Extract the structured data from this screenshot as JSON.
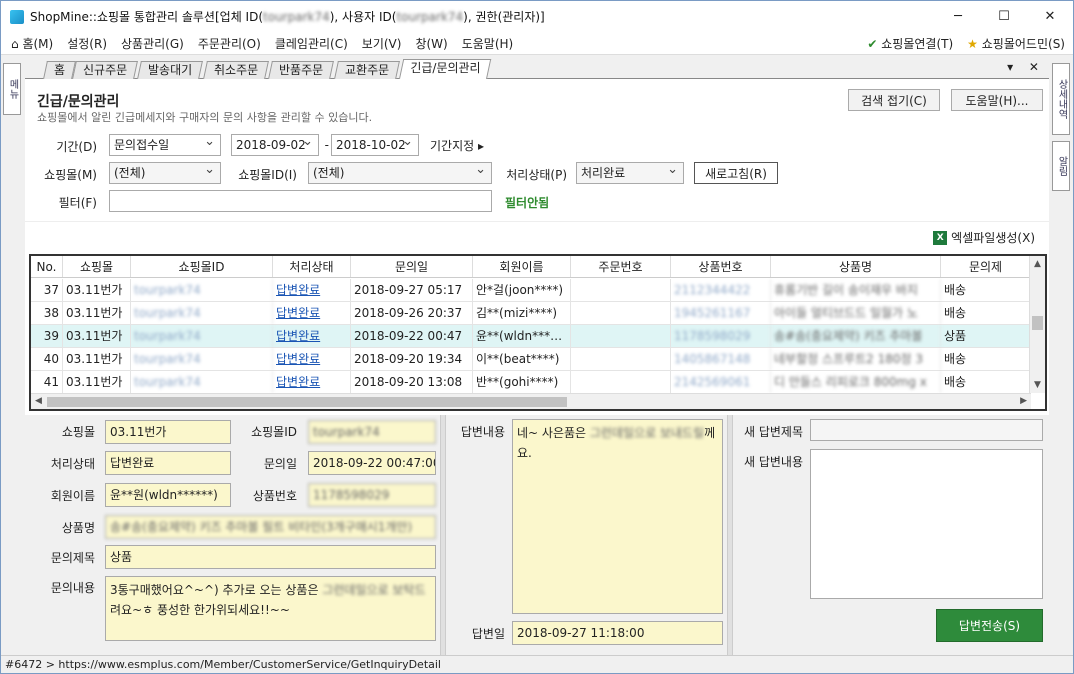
{
  "titlebar": {
    "title": "ShopMine::쇼핑몰 통합관리 솔루션[업체 ID(",
    "title_blur1": "tourpark74",
    "title_mid": "), 사용자 ID(",
    "title_blur2": "tourpark74",
    "title_end": "), 권한(관리자)]",
    "min": "─",
    "max": "☐",
    "close": "✕"
  },
  "menu": {
    "home": "홈(M)",
    "settings": "설정(R)",
    "product": "상품관리(G)",
    "order": "주문관리(O)",
    "claim": "클레임관리(C)",
    "view": "보기(V)",
    "window": "창(W)",
    "help": "도움말(H)",
    "mall_connect": "쇼핑몰연결(T)",
    "mall_admin": "쇼핑몰어드민(S)"
  },
  "side": {
    "menu": "메뉴",
    "detail": "상세내역",
    "alarm": "알림"
  },
  "tabs": [
    "홈",
    "신규주문",
    "발송대기",
    "취소주문",
    "반품주문",
    "교환주문",
    "긴급/문의관리"
  ],
  "tabctl": "▾ ✕",
  "panel": {
    "title": "긴급/문의관리",
    "subtitle": "쇼핑몰에서 알린 긴급메세지와 구매자의 문의 사항을 관리할 수 있습니다.",
    "collapse_btn": "검색 접기(C)",
    "help_btn": "도움말(H)...",
    "period_label": "기간(D)",
    "period_type": "문의접수일",
    "date_from": "2018-09-02",
    "date_sep": "-",
    "date_to": "2018-10-02",
    "period_set": "기간지정 ▸",
    "mall_label": "쇼핑몰(M)",
    "mall_value": "(전체)",
    "mallid_label": "쇼핑몰ID(I)",
    "mallid_value": "(전체)",
    "state_label": "처리상태(P)",
    "state_value": "처리완료",
    "refresh_btn": "새로고침(R)",
    "filter_label": "필터(F)",
    "filter_value": "",
    "filter_status": "필터안됨",
    "excel": "엑셀파일생성(X)"
  },
  "table": {
    "headers": [
      "No.",
      "쇼핑몰",
      "쇼핑몰ID",
      "처리상태",
      "문의일",
      "회원이름",
      "주문번호",
      "상품번호",
      "상품명",
      "문의제"
    ],
    "rows": [
      {
        "no": "37",
        "mall": "03.11번가",
        "mallid": "tourpark74",
        "state": "답변완료",
        "date": "2018-09-27 05:17",
        "member": "안*걸(joon****)",
        "order": "",
        "product_no": "2112344422",
        "product_name": "휴롬기반 길이 송이재우 바지",
        "type": "배송"
      },
      {
        "no": "38",
        "mall": "03.11번가",
        "mallid": "tourpark74",
        "state": "답변완료",
        "date": "2018-09-26 20:37",
        "member": "김**(mizi****)",
        "order": "",
        "product_no": "1945261167",
        "product_name": "아이들 얼티브드드 일월가 노",
        "type": "배송"
      },
      {
        "no": "39",
        "mall": "03.11번가",
        "mallid": "tourpark74",
        "state": "답변완료",
        "date": "2018-09-22 00:47",
        "member": "윤**(wldn***…",
        "order": "",
        "product_no": "1178598029",
        "product_name": "송#송(충요제약) 키즈 추마볼",
        "type": "상품"
      },
      {
        "no": "40",
        "mall": "03.11번가",
        "mallid": "tourpark74",
        "state": "답변완료",
        "date": "2018-09-20 19:34",
        "member": "이**(beat****)",
        "order": "",
        "product_no": "1405867148",
        "product_name": "네부할정 스프루트2 180정 3",
        "type": "배송"
      },
      {
        "no": "41",
        "mall": "03.11번가",
        "mallid": "tourpark74",
        "state": "답변완료",
        "date": "2018-09-20 13:08",
        "member": "반**(gohi****)",
        "order": "",
        "product_no": "2142569061",
        "product_name": "디 만들스 리피로크 800mg x",
        "type": "배송"
      }
    ]
  },
  "detail": {
    "mall_label": "쇼핑몰",
    "mall": "03.11번가",
    "mallid_label": "쇼핑몰ID",
    "mallid": "tourpark74",
    "state_label": "처리상태",
    "state": "답변완료",
    "date_label": "문의일",
    "date": "2018-09-22 00:47:00",
    "member_label": "회원이름",
    "member": "윤**원(wldn******)",
    "pno_label": "상품번호",
    "pno": "1178598029",
    "pname_label": "상품명",
    "pname": "송#송(충요제약) 키즈 추마볼 필트 비타민(3개구매시1개만)",
    "subject_label": "문의제목",
    "subject": "상품",
    "content_label": "문의내용",
    "content_a": "3통구매했어요^~^) 추가로 오는 상품은 ",
    "content_blur": "그런데일으로 보탁드",
    "content_b": "려요~ㅎ 풍성한 한가위되세요!!~~",
    "answer_label": "답변내용",
    "answer_a": "네~ 사은품은 ",
    "answer_blur": "그런데일으로 보내드릴",
    "answer_b": "께요.",
    "answer_date_label": "답변일",
    "answer_date": "2018-09-27 11:18:00",
    "new_title_label": "새 답변제목",
    "new_title": "",
    "new_content_label": "새 답변내용",
    "new_content": "",
    "send_btn": "답변전송(S)"
  },
  "status": "#6472 > https://www.esmplus.com/Member/CustomerService/GetInquiryDetail"
}
